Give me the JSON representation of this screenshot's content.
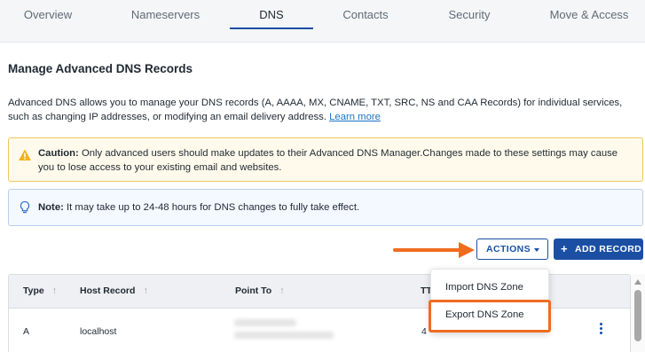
{
  "tabs": [
    {
      "label": "Overview"
    },
    {
      "label": "Nameservers"
    },
    {
      "label": "DNS",
      "active": true
    },
    {
      "label": "Contacts"
    },
    {
      "label": "Security"
    },
    {
      "label": "Move & Access"
    }
  ],
  "main": {
    "title": "Manage Advanced DNS Records",
    "intro_text": "Advanced DNS allows you to manage your DNS records (A, AAAA, MX, CNAME, TXT, SRC, NS and CAA Records) for individual services, such as changing IP addresses, or modifying an email delivery address.",
    "learn_more": "Learn more"
  },
  "alerts": {
    "caution_label": "Caution:",
    "caution_text": "Only advanced users should make updates to their Advanced DNS Manager.Changes made to these settings may cause you to lose access to your existing email and websites.",
    "note_label": "Note:",
    "note_text": "It may take up to 24-48 hours for DNS changes to fully take effect."
  },
  "toolbar": {
    "actions_label": "ACTIONS",
    "add_record_label": "ADD RECORD"
  },
  "actions_menu": {
    "items": [
      "Import DNS Zone",
      "Export DNS Zone"
    ],
    "highlighted": "Export DNS Zone"
  },
  "table": {
    "columns": [
      "Type",
      "Host Record",
      "Point To",
      "TTL"
    ],
    "rows": [
      {
        "type": "A",
        "host": "localhost",
        "ttl_partial": "4"
      }
    ]
  },
  "colors": {
    "primary": "#1a4fa3",
    "highlight": "#ef6c1f",
    "caution_border": "#f0c75e",
    "note_border": "#b8cff0"
  },
  "icons": {
    "caution": "warning-triangle-icon",
    "note": "lightbulb-icon",
    "sort": "sort-arrow-up-icon",
    "row_menu": "kebab-menu-icon"
  }
}
